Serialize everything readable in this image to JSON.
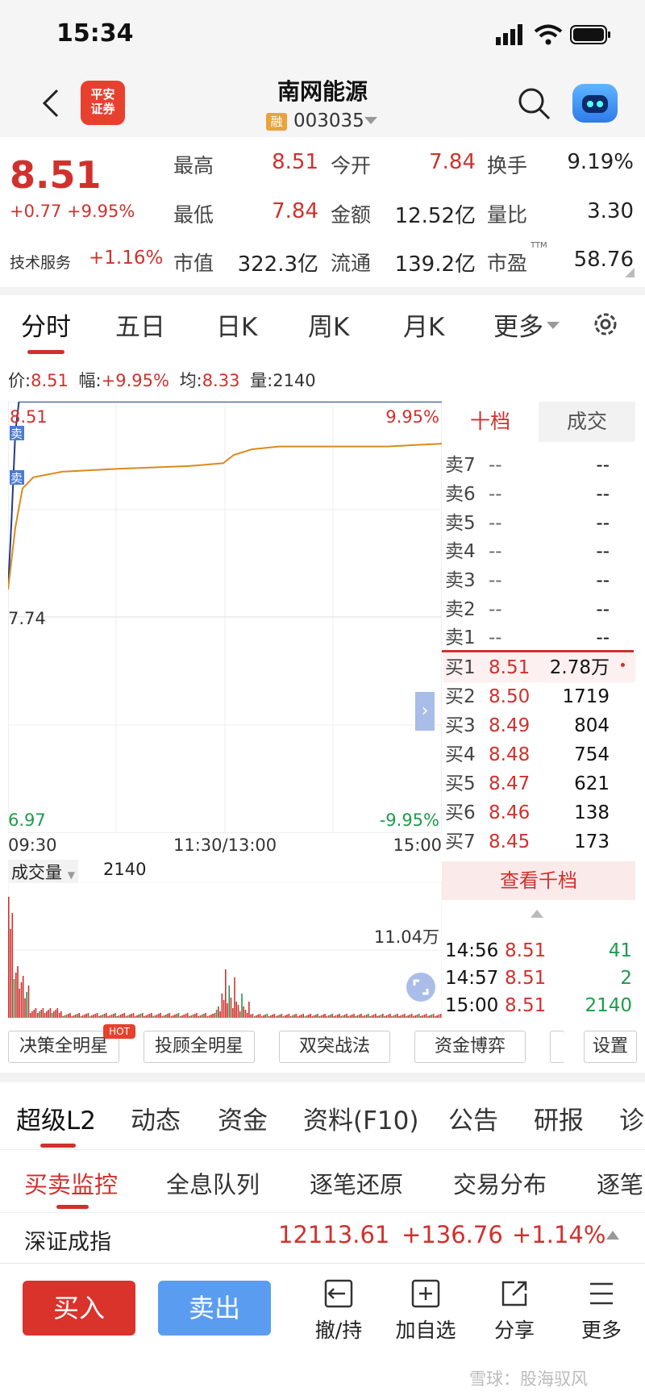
{
  "status_bar": {
    "time": "15:34"
  },
  "header": {
    "logo_top": "平安",
    "logo_bottom": "证券",
    "stock_name": "南网能源",
    "margin_badge": "融",
    "stock_code": "003035"
  },
  "quote": {
    "price": "8.51",
    "change": "+0.77 +9.95%",
    "sector_name": "技术服务",
    "sector_change": "+1.16%",
    "stats": [
      {
        "label": "最高",
        "value": "8.51",
        "color": "red"
      },
      {
        "label": "今开",
        "value": "7.84",
        "color": "red"
      },
      {
        "label": "换手",
        "value": "9.19%",
        "color": "black"
      },
      {
        "label": "最低",
        "value": "7.84",
        "color": "red"
      },
      {
        "label": "金额",
        "value": "12.52亿",
        "color": "black"
      },
      {
        "label": "量比",
        "value": "3.30",
        "color": "black"
      },
      {
        "label": "市值",
        "value": "322.3亿",
        "color": "black"
      },
      {
        "label": "流通",
        "value": "139.2亿",
        "color": "black"
      },
      {
        "label": "市盈",
        "value": "58.76",
        "color": "black"
      }
    ],
    "ttm": "TTM"
  },
  "chart_tabs": [
    "分时",
    "五日",
    "日K",
    "周K",
    "月K",
    "更多"
  ],
  "info_line": {
    "price_label": "价:",
    "price": "8.51",
    "amp_label": "幅:",
    "amp": "+9.95%",
    "avg_label": "均:",
    "avg": "8.33",
    "vol_label": "量:",
    "vol": "2140"
  },
  "chart_data": {
    "type": "line",
    "y_top_label": "8.51",
    "y_mid_label": "7.74",
    "y_bottom_label": "6.97",
    "pct_top_label": "9.95%",
    "pct_bottom_label": "-9.95%",
    "x_labels": [
      "09:30",
      "11:30/13:00",
      "15:00"
    ],
    "ylim": [
      6.97,
      8.51
    ],
    "markers": [
      "卖",
      "卖"
    ],
    "series": [
      {
        "points": [
          [
            0,
            7.84
          ],
          [
            2,
            8.1
          ],
          [
            4,
            8.4
          ],
          [
            6,
            8.51
          ],
          [
            240,
            8.51
          ]
        ]
      },
      {
        "points": [
          [
            0,
            7.84
          ],
          [
            4,
            8.06
          ],
          [
            8,
            8.2
          ],
          [
            14,
            8.24
          ],
          [
            30,
            8.26
          ],
          [
            60,
            8.27
          ],
          [
            100,
            8.28
          ],
          [
            119,
            8.29
          ],
          [
            125,
            8.32
          ],
          [
            135,
            8.34
          ],
          [
            150,
            8.35
          ],
          [
            180,
            8.35
          ],
          [
            210,
            8.35
          ],
          [
            240,
            8.36
          ]
        ]
      }
    ]
  },
  "volume": {
    "label": "成交量",
    "current": "2140",
    "max_label": "11.04万"
  },
  "order_book": {
    "tab_active": "十档",
    "tab_other": "成交",
    "asks": [
      {
        "label": "卖7",
        "price": "--",
        "vol": "--"
      },
      {
        "label": "卖6",
        "price": "--",
        "vol": "--"
      },
      {
        "label": "卖5",
        "price": "--",
        "vol": "--"
      },
      {
        "label": "卖4",
        "price": "--",
        "vol": "--"
      },
      {
        "label": "卖3",
        "price": "--",
        "vol": "--"
      },
      {
        "label": "卖2",
        "price": "--",
        "vol": "--"
      },
      {
        "label": "卖1",
        "price": "--",
        "vol": "--"
      }
    ],
    "bids": [
      {
        "label": "买1",
        "price": "8.51",
        "vol": "2.78万"
      },
      {
        "label": "买2",
        "price": "8.50",
        "vol": "1719"
      },
      {
        "label": "买3",
        "price": "8.49",
        "vol": "804"
      },
      {
        "label": "买4",
        "price": "8.48",
        "vol": "754"
      },
      {
        "label": "买5",
        "price": "8.47",
        "vol": "621"
      },
      {
        "label": "买6",
        "price": "8.46",
        "vol": "138"
      },
      {
        "label": "买7",
        "price": "8.45",
        "vol": "173"
      }
    ],
    "view_thousand": "查看千档",
    "deals": [
      {
        "time": "14:56",
        "price": "8.51",
        "vol": "41"
      },
      {
        "time": "14:57",
        "price": "8.51",
        "vol": "2"
      },
      {
        "time": "15:00",
        "price": "8.51",
        "vol": "2140"
      }
    ]
  },
  "strategy_buttons": [
    "决策全明星",
    "投顾全明星",
    "双突战法",
    "资金博弈",
    "设置"
  ],
  "hot_badge": "HOT",
  "info_tabs": [
    "超级L2",
    "动态",
    "资金",
    "资料(F10)",
    "公告",
    "研报",
    "诊"
  ],
  "sub_tabs": [
    "买卖监控",
    "全息队列",
    "逐笔还原",
    "交易分布",
    "逐笔"
  ],
  "index": {
    "name": "深证成指",
    "value": "12113.61",
    "change": "+136.76",
    "pct": "+1.14%"
  },
  "bottom_bar": {
    "buy": "买入",
    "sell": "卖出",
    "actions": [
      "撤/持",
      "加自选",
      "分享",
      "更多"
    ]
  },
  "watermark": "雪球：股海驭风"
}
